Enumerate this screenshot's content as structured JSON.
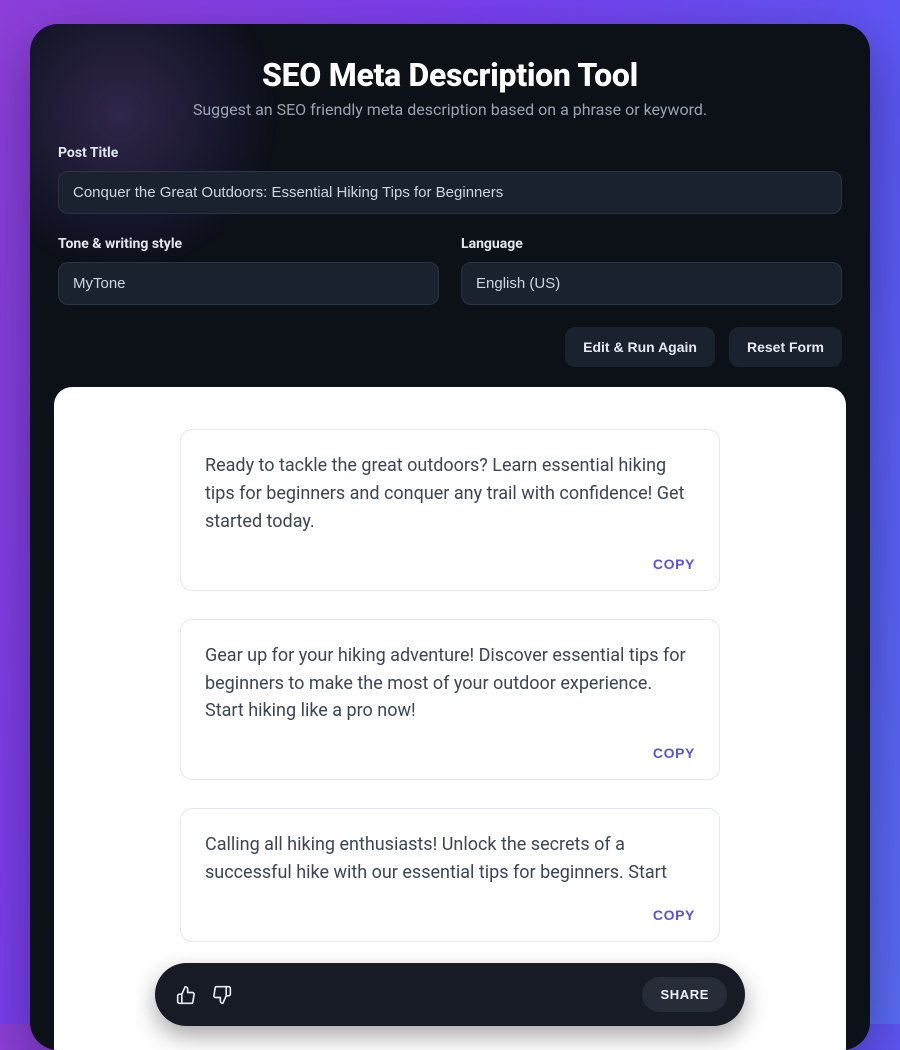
{
  "header": {
    "title": "SEO Meta Description Tool",
    "subtitle": "Suggest an SEO friendly meta description based on a phrase or keyword."
  },
  "form": {
    "post_title_label": "Post Title",
    "post_title_value": "Conquer the Great Outdoors: Essential Hiking Tips for Beginners",
    "tone_label": "Tone & writing style",
    "tone_value": "MyTone",
    "language_label": "Language",
    "language_value": "English (US)"
  },
  "actions": {
    "edit_run_label": "Edit & Run Again",
    "reset_label": "Reset Form"
  },
  "results": [
    {
      "text": "Ready to tackle the great outdoors? Learn essential hiking tips for beginners and conquer any trail with confidence! Get started today.",
      "copy_label": "COPY"
    },
    {
      "text": "Gear up for your hiking adventure! Discover essential tips for beginners to make the most of your outdoor experience. Start hiking like a pro now!",
      "copy_label": "COPY"
    },
    {
      "text": "Calling all hiking enthusiasts! Unlock the secrets of a successful hike with our essential tips for beginners. Start",
      "copy_label": "COPY"
    }
  ],
  "bottom_bar": {
    "share_label": "SHARE"
  }
}
